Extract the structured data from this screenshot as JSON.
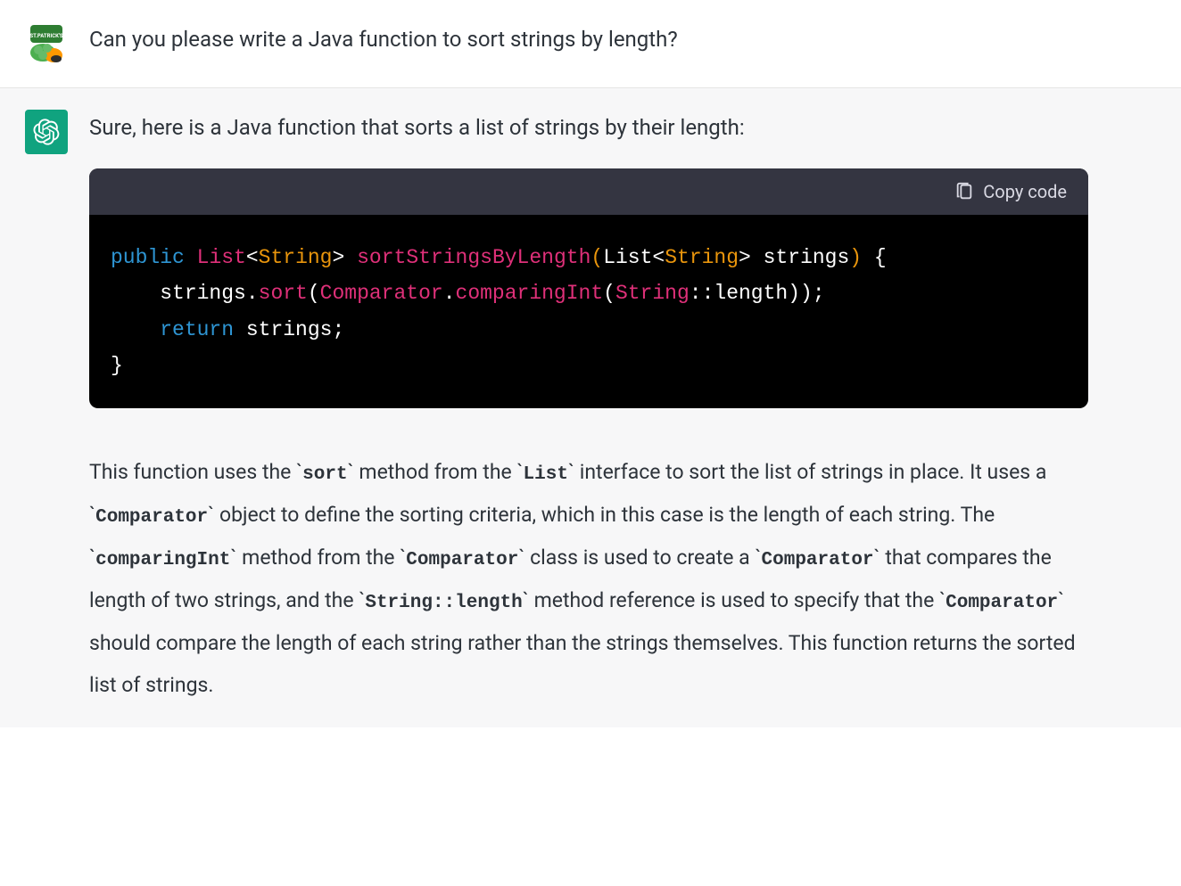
{
  "user": {
    "question": "Can you please write a Java function to sort strings by length?"
  },
  "assistant": {
    "intro": "Sure, here is a Java function that sorts a list of strings by their length:",
    "copy_label": "Copy code",
    "code": {
      "kw_public": "public",
      "type_list": "List",
      "lt1": "<",
      "generic_string1": "String",
      "gt1": ">",
      "space1": " ",
      "func_name": "sortStringsByLength",
      "open_paren1": "(",
      "param_list": "List",
      "lt2": "<",
      "generic_string2": "String",
      "gt2": ">",
      "param_name": " strings",
      "close_paren1": ")",
      "open_brace": " {",
      "line2_indent": "    strings.",
      "sort_call": "sort",
      "open_paren2": "(",
      "comparator": "Comparator",
      "dot": ".",
      "comparing_int": "comparingInt",
      "open_paren3": "(",
      "string_ref": "String",
      "double_colon": "::length",
      "close_parens": "));",
      "line3_indent": "    ",
      "kw_return": "return",
      "return_val": " strings;",
      "close_brace": "}"
    },
    "explanation": {
      "p1a": "This function uses the ",
      "c1": "sort",
      "p1b": " method from the ",
      "c2": "List",
      "p1c": " interface to sort the list of strings in place. It uses a ",
      "c3": "Comparator",
      "p1d": " object to define the sorting criteria, which in this case is the length of each string. The ",
      "c4": "comparingInt",
      "p1e": " method from the ",
      "c5": "Comparator",
      "p1f": " class is used to create a ",
      "c6": "Comparator",
      "p1g": " that compares the length of two strings, and the ",
      "c7": "String::length",
      "p1h": " method reference is used to specify that the ",
      "c8": "Comparator",
      "p1i": " should compare the length of each string rather than the strings themselves. This function returns the sorted list of strings."
    }
  }
}
